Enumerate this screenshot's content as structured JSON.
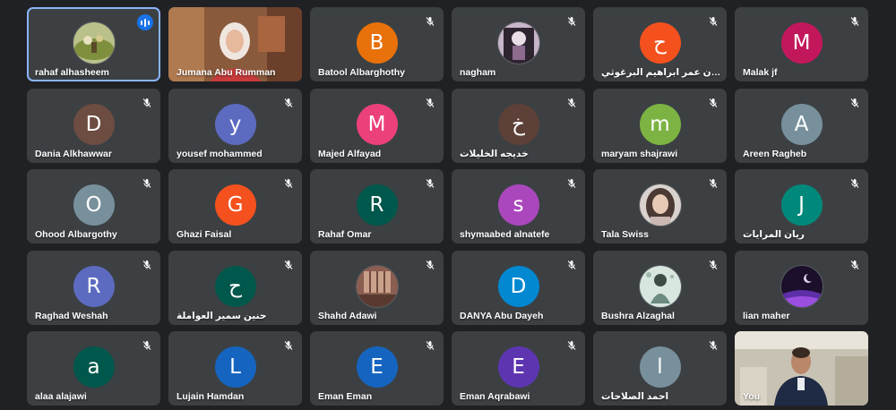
{
  "participants": [
    {
      "name": "rahaf alhasheem",
      "type": "photo",
      "photo": "field",
      "muted": false,
      "speaking": true
    },
    {
      "name": "Jumana Abu Rumman",
      "type": "video",
      "video": "jumana",
      "muted": false,
      "speaking": false
    },
    {
      "name": "Batool Albarghothy",
      "type": "initial",
      "initial": "B",
      "color": "#e8710a",
      "muted": true
    },
    {
      "name": "nagham",
      "type": "photo",
      "photo": "doll",
      "muted": true
    },
    {
      "name": "حنان عمر ابراهيم البرغوثي",
      "type": "initial",
      "initial": "ح",
      "color": "#f4511e",
      "muted": true
    },
    {
      "name": "Malak jf",
      "type": "initial",
      "initial": "M",
      "color": "#c2185b",
      "muted": true
    },
    {
      "name": "Dania Alkhawwar",
      "type": "initial",
      "initial": "D",
      "color": "#6d4c41",
      "muted": true
    },
    {
      "name": "yousef mohammed",
      "type": "initial",
      "initial": "y",
      "color": "#5c6bc0",
      "muted": true
    },
    {
      "name": "Majed Alfayad",
      "type": "initial",
      "initial": "M",
      "color": "#ec407a",
      "muted": true
    },
    {
      "name": "خديجه الخليلات",
      "type": "initial",
      "initial": "خ",
      "color": "#5d4037",
      "muted": true
    },
    {
      "name": "maryam shajrawi",
      "type": "initial",
      "initial": "m",
      "color": "#7cb342",
      "muted": true
    },
    {
      "name": "Areen Ragheb",
      "type": "initial",
      "initial": "A",
      "color": "#78909c",
      "muted": true
    },
    {
      "name": "Ohood Albargothy",
      "type": "initial",
      "initial": "O",
      "color": "#78909c",
      "muted": true
    },
    {
      "name": "Ghazi Faisal",
      "type": "initial",
      "initial": "G",
      "color": "#f4511e",
      "muted": true
    },
    {
      "name": "Rahaf Omar",
      "type": "initial",
      "initial": "R",
      "color": "#00574b",
      "muted": true
    },
    {
      "name": "shymaabed alnatefe",
      "type": "initial",
      "initial": "s",
      "color": "#ab47bc",
      "muted": true
    },
    {
      "name": "Tala Swiss",
      "type": "photo",
      "photo": "girl",
      "muted": true
    },
    {
      "name": "ريان المرايات",
      "type": "initial",
      "initial": "J",
      "color": "#00897b",
      "muted": true
    },
    {
      "name": "Raghad Weshah",
      "type": "initial",
      "initial": "R",
      "color": "#5c6bc0",
      "muted": true
    },
    {
      "name": "حنين سمير العواملة",
      "type": "initial",
      "initial": "ح",
      "color": "#00574b",
      "muted": true
    },
    {
      "name": "Shahd Adawi",
      "type": "photo",
      "photo": "room",
      "muted": true
    },
    {
      "name": "DANYA Abu Dayeh",
      "type": "initial",
      "initial": "D",
      "color": "#0288d1",
      "muted": true
    },
    {
      "name": "Bushra Alzaghal",
      "type": "photo",
      "photo": "figure",
      "muted": true
    },
    {
      "name": "lian maher",
      "type": "photo",
      "photo": "night",
      "muted": true
    },
    {
      "name": "alaa alajawi",
      "type": "initial",
      "initial": "a",
      "color": "#00574b",
      "muted": true
    },
    {
      "name": "Lujain Hamdan",
      "type": "initial",
      "initial": "L",
      "color": "#1565c0",
      "muted": true
    },
    {
      "name": "Eman Eman",
      "type": "initial",
      "initial": "E",
      "color": "#1565c0",
      "muted": true
    },
    {
      "name": "Eman Aqrabawi",
      "type": "initial",
      "initial": "E",
      "color": "#5e35b1",
      "muted": true
    },
    {
      "name": "احمد الصلاحات",
      "type": "initial",
      "initial": "ا",
      "color": "#78909c",
      "muted": true
    },
    {
      "name": "You",
      "type": "video",
      "video": "self",
      "muted": false,
      "speaking": false
    }
  ]
}
